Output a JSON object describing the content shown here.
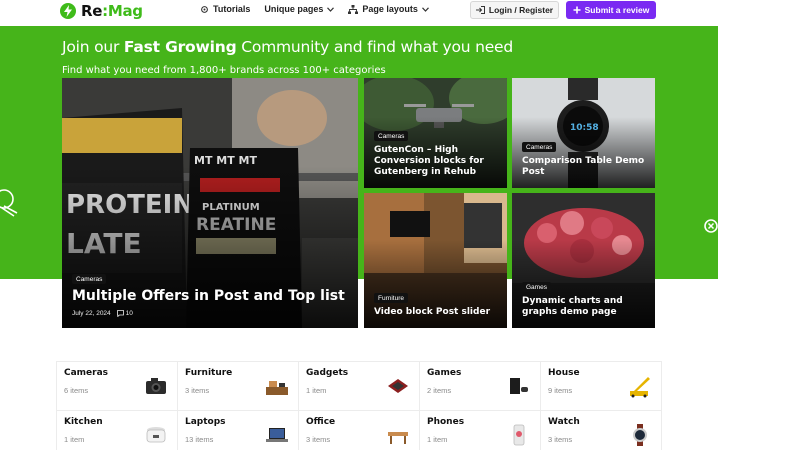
{
  "header": {
    "logo": {
      "prefix": "Re",
      "suffix": ":Mag"
    },
    "nav": [
      {
        "label": "Tutorials",
        "icon": "gear-icon"
      },
      {
        "label": "Unique pages",
        "icon": "chevron-down-icon"
      },
      {
        "label": "Page layouts",
        "icon": "sitemap-icon"
      }
    ],
    "login_label": "Login / Register",
    "submit_label": "Submit a review"
  },
  "hero": {
    "title_pre": "Join our ",
    "title_bold": "Fast Growing",
    "title_post": " Community and find what you need",
    "subtitle": "Find what you need from 1,800+ brands across 100+ categories"
  },
  "cards": {
    "main": {
      "category": "Cameras",
      "title": "Multiple Offers in Post and Top list",
      "date": "July 22, 2024",
      "comments": "10"
    },
    "a": {
      "category": "Cameras",
      "title": "GutenCon – High Conversion blocks for Gutenberg in Rehub"
    },
    "b": {
      "category": "Cameras",
      "title": "Comparison Table Demo Post"
    },
    "c": {
      "category": "Furniture",
      "title": "Video block Post slider"
    },
    "d": {
      "category": "Games",
      "title": "Dynamic charts and graphs demo page"
    }
  },
  "categories": [
    {
      "name": "Cameras",
      "count": "6 items",
      "icon": "camera-icon"
    },
    {
      "name": "Furniture",
      "count": "3 items",
      "icon": "furniture-icon"
    },
    {
      "name": "Gadgets",
      "count": "1 item",
      "icon": "gadget-icon"
    },
    {
      "name": "Games",
      "count": "2 items",
      "icon": "gamepad-icon"
    },
    {
      "name": "House",
      "count": "9 items",
      "icon": "crane-icon"
    },
    {
      "name": "Kitchen",
      "count": "1 item",
      "icon": "cooker-icon"
    },
    {
      "name": "Laptops",
      "count": "13 items",
      "icon": "laptop-icon"
    },
    {
      "name": "Office",
      "count": "3 items",
      "icon": "desk-icon"
    },
    {
      "name": "Phones",
      "count": "1 item",
      "icon": "phone-icon"
    },
    {
      "name": "Watch",
      "count": "3 items",
      "icon": "watch-icon"
    }
  ],
  "colors": {
    "brand_green": "#46b41a",
    "accent_purple": "#7a2af2"
  }
}
